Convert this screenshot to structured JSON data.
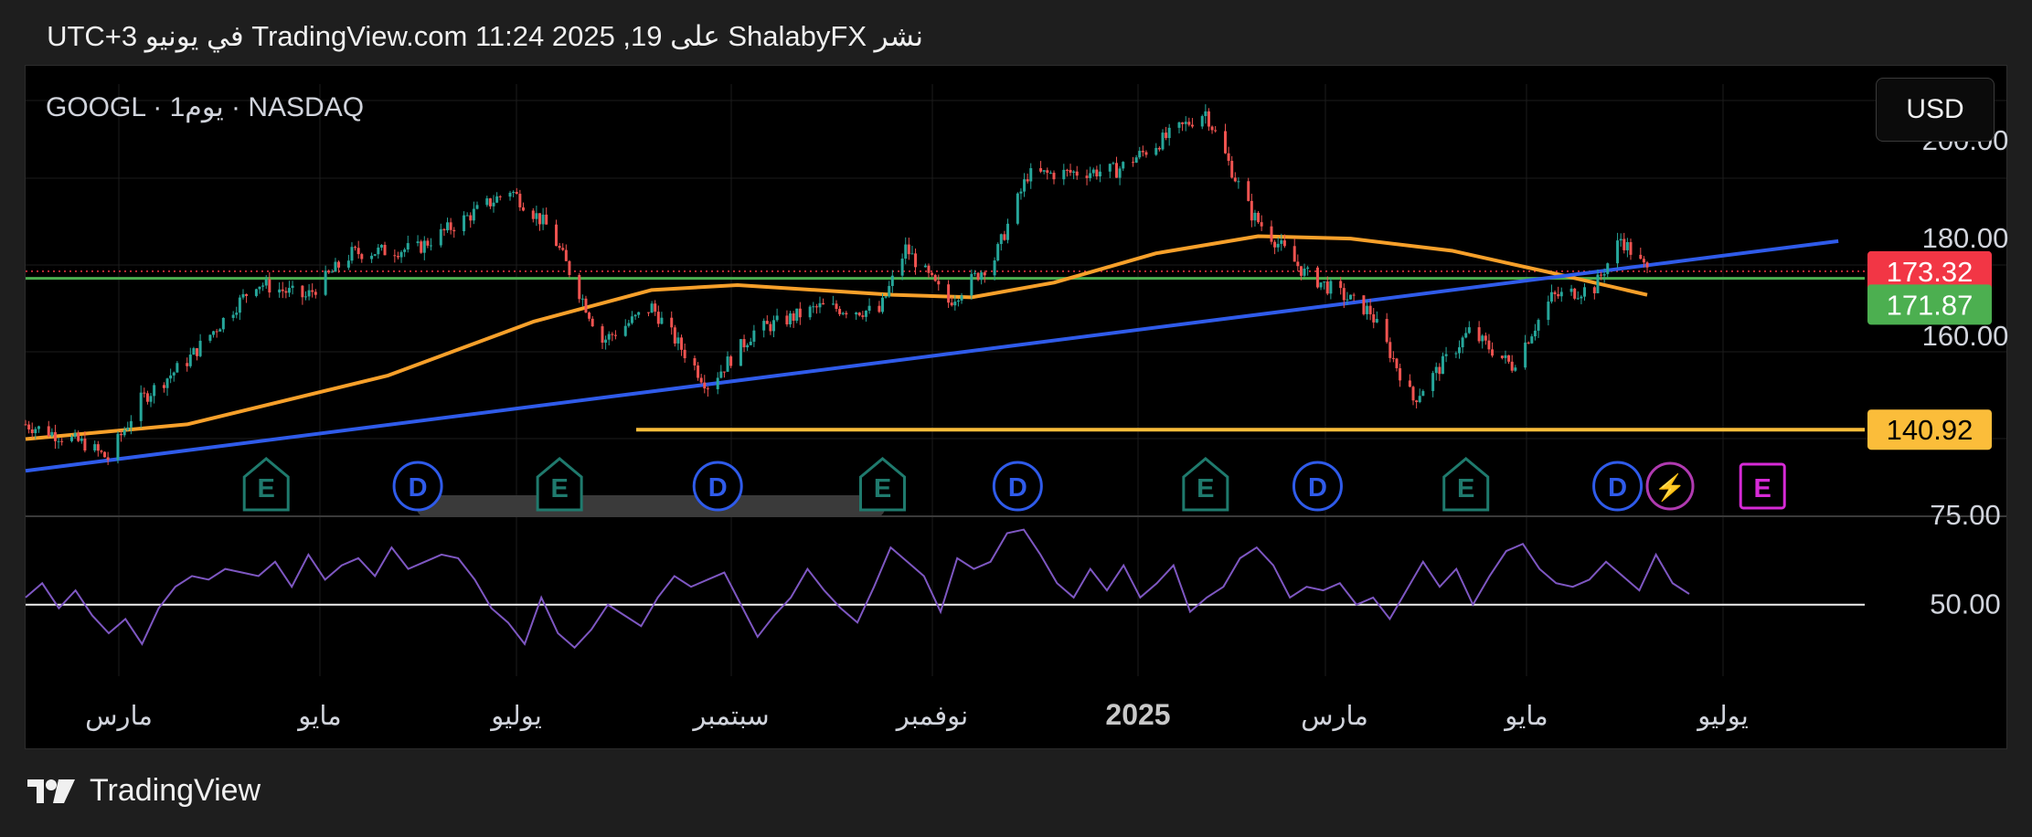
{
  "header": {
    "text": "نشر ShalabyFX على TradingView.com 11:24 2025 ,19 في يونيو UTC+3"
  },
  "symbol_label": "GOOGL · 1يوم · NASDAQ",
  "currency_button": "USD",
  "footer": {
    "brand": "TradingView",
    "logo_icon": "tradingview-logo-icon"
  },
  "colors": {
    "up": "#26a69a",
    "down": "#ef5350",
    "ma": "#f7a02a",
    "trend": "#2f5bea",
    "support": "#fbbd3a",
    "resistance": "#4caf50",
    "rsi": "#7e57c2",
    "price_label": "#f23645"
  },
  "chart_data": [
    {
      "type": "candlestick",
      "title": "GOOGL · 1يوم · NASDAQ",
      "y_axis_ticks": [
        200.0,
        180.0,
        160.0
      ],
      "y_axis_tick_labels": [
        "200.00",
        "180.00",
        "160.00"
      ],
      "x_axis_labels": [
        "مارس",
        "مايو",
        "يوليو",
        "سبتمبر",
        "نوفمبر",
        "2025",
        "مارس",
        "مايو",
        "يوليو"
      ],
      "ylim": [
        126,
        212
      ],
      "grid": true,
      "price_labels": [
        {
          "value": "173.32",
          "color": "#f23645",
          "kind": "last-price"
        },
        {
          "value": "171.87",
          "color": "#4caf50",
          "kind": "horizontal-level"
        },
        {
          "value": "140.92",
          "color": "#fbbd3a",
          "kind": "support-level"
        }
      ],
      "close_series": [
        {
          "date": "2024-02-12",
          "close": 142
        },
        {
          "date": "2024-03-01",
          "close": 138
        },
        {
          "date": "2024-03-08",
          "close": 135
        },
        {
          "date": "2024-03-18",
          "close": 147
        },
        {
          "date": "2024-04-01",
          "close": 155
        },
        {
          "date": "2024-04-22",
          "close": 171
        },
        {
          "date": "2024-05-07",
          "close": 168
        },
        {
          "date": "2024-05-21",
          "close": 177
        },
        {
          "date": "2024-06-10",
          "close": 178
        },
        {
          "date": "2024-07-08",
          "close": 190
        },
        {
          "date": "2024-07-20",
          "close": 182
        },
        {
          "date": "2024-08-05",
          "close": 159
        },
        {
          "date": "2024-08-20",
          "close": 166
        },
        {
          "date": "2024-09-06",
          "close": 150
        },
        {
          "date": "2024-09-20",
          "close": 161
        },
        {
          "date": "2024-10-10",
          "close": 166
        },
        {
          "date": "2024-10-28",
          "close": 165
        },
        {
          "date": "2024-11-05",
          "close": 178
        },
        {
          "date": "2024-11-18",
          "close": 167
        },
        {
          "date": "2024-12-02",
          "close": 176
        },
        {
          "date": "2024-12-12",
          "close": 193
        },
        {
          "date": "2025-01-08",
          "close": 194
        },
        {
          "date": "2025-02-04",
          "close": 206
        },
        {
          "date": "2025-02-18",
          "close": 185
        },
        {
          "date": "2025-03-06",
          "close": 173
        },
        {
          "date": "2025-03-26",
          "close": 165
        },
        {
          "date": "2025-04-08",
          "close": 147
        },
        {
          "date": "2025-04-25",
          "close": 161
        },
        {
          "date": "2025-05-08",
          "close": 154
        },
        {
          "date": "2025-05-20",
          "close": 168
        },
        {
          "date": "2025-06-02",
          "close": 170
        },
        {
          "date": "2025-06-10",
          "close": 180
        },
        {
          "date": "2025-06-18",
          "close": 173.32
        }
      ],
      "moving_average": [
        {
          "date": "2024-02-12",
          "value": 139
        },
        {
          "date": "2024-04-01",
          "value": 142
        },
        {
          "date": "2024-06-01",
          "value": 152
        },
        {
          "date": "2024-07-15",
          "value": 163
        },
        {
          "date": "2024-08-20",
          "value": 169.5
        },
        {
          "date": "2024-09-15",
          "value": 170.5
        },
        {
          "date": "2024-11-01",
          "value": 168.5
        },
        {
          "date": "2024-11-25",
          "value": 168
        },
        {
          "date": "2024-12-20",
          "value": 171
        },
        {
          "date": "2025-01-20",
          "value": 177
        },
        {
          "date": "2025-02-20",
          "value": 180.5
        },
        {
          "date": "2025-03-20",
          "value": 180
        },
        {
          "date": "2025-04-20",
          "value": 177.5
        },
        {
          "date": "2025-05-20",
          "value": 173
        },
        {
          "date": "2025-06-18",
          "value": 168.5
        }
      ],
      "trendline": [
        {
          "date": "2024-02-12",
          "value": 132.5
        },
        {
          "date": "2025-08-15",
          "value": 179.5
        }
      ],
      "event_markers": [
        {
          "label": "E",
          "kind": "earnings",
          "date": "2024-04-25"
        },
        {
          "label": "D",
          "kind": "dividend",
          "date": "2024-06-10"
        },
        {
          "label": "E",
          "kind": "earnings",
          "date": "2024-07-23"
        },
        {
          "label": "D",
          "kind": "dividend",
          "date": "2024-09-09"
        },
        {
          "label": "E",
          "kind": "earnings",
          "date": "2024-10-29"
        },
        {
          "label": "D",
          "kind": "dividend",
          "date": "2024-12-09"
        },
        {
          "label": "E",
          "kind": "earnings",
          "date": "2025-02-04"
        },
        {
          "label": "D",
          "kind": "dividend",
          "date": "2025-03-10"
        },
        {
          "label": "E",
          "kind": "earnings",
          "date": "2025-04-24"
        },
        {
          "label": "D",
          "kind": "dividend",
          "date": "2025-06-09"
        },
        {
          "label": "⚡",
          "kind": "split",
          "date": "2025-06-18"
        },
        {
          "label": "E",
          "kind": "upcoming-earnings",
          "date": "2025-07-23"
        }
      ]
    },
    {
      "type": "line",
      "title": "",
      "y_axis_ticks": [
        75.0,
        50.0
      ],
      "y_axis_tick_labels": [
        "75.00",
        "50.00"
      ],
      "reference_line": 50,
      "ylim": [
        30,
        76
      ],
      "values": [
        52,
        56,
        49,
        54,
        47,
        42,
        46,
        39,
        49,
        55,
        58,
        57,
        60,
        59,
        58,
        62,
        55,
        64,
        57,
        61,
        63,
        58,
        66,
        60,
        62,
        64,
        63,
        57,
        49,
        45,
        39,
        52,
        42,
        38,
        43,
        50,
        47,
        44,
        52,
        58,
        55,
        57,
        59,
        50,
        41,
        47,
        52,
        60,
        54,
        49,
        45,
        55,
        66,
        62,
        58,
        48,
        63,
        60,
        62,
        70,
        71,
        64,
        56,
        52,
        60,
        54,
        61,
        52,
        56,
        61,
        48,
        52,
        55,
        63,
        66,
        61,
        52,
        55,
        54,
        56,
        50,
        52,
        46,
        54,
        62,
        55,
        60,
        50,
        58,
        65,
        67,
        60,
        56,
        55,
        57,
        62,
        58,
        54,
        64,
        56,
        53
      ]
    }
  ]
}
